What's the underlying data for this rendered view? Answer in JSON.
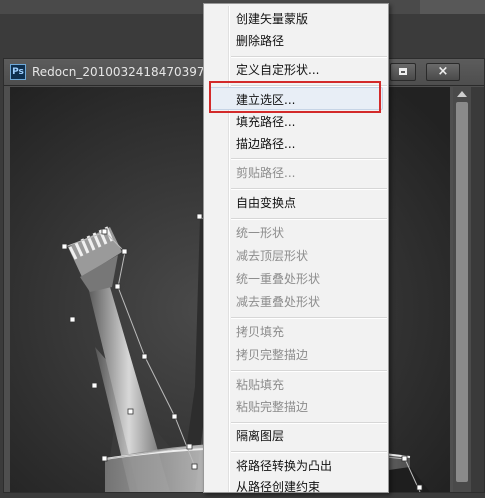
{
  "document": {
    "title": "Redocn_2010032418470397.jpg",
    "app_icon": "Ps",
    "close_label": "×"
  },
  "context_menu": {
    "highlighted_item": "建立选区...",
    "items": [
      {
        "label": "创建矢量蒙版",
        "enabled": true
      },
      {
        "label": "删除路径",
        "enabled": true
      },
      {
        "label": "定义自定形状...",
        "enabled": true
      },
      {
        "label": "建立选区...",
        "enabled": true
      },
      {
        "label": "填充路径...",
        "enabled": true
      },
      {
        "label": "描边路径...",
        "enabled": true
      },
      {
        "label": "剪贴路径...",
        "enabled": false
      },
      {
        "label": "自由变换点",
        "enabled": true
      },
      {
        "label": "统一形状",
        "enabled": false
      },
      {
        "label": "减去顶层形状",
        "enabled": false
      },
      {
        "label": "统一重叠处形状",
        "enabled": false
      },
      {
        "label": "减去重叠处形状",
        "enabled": false
      },
      {
        "label": "拷贝填充",
        "enabled": false
      },
      {
        "label": "拷贝完整描边",
        "enabled": false
      },
      {
        "label": "粘贴填充",
        "enabled": false
      },
      {
        "label": "粘贴完整描边",
        "enabled": false
      },
      {
        "label": "隔离图层",
        "enabled": true
      },
      {
        "label": "将路径转换为凸出",
        "enabled": true
      },
      {
        "label": "从路径创建约束",
        "enabled": true
      }
    ]
  },
  "colors": {
    "highlight_outline": "#d32a2a",
    "menu_background": "#f2f2f2",
    "disabled_text": "#8d8d8d"
  }
}
